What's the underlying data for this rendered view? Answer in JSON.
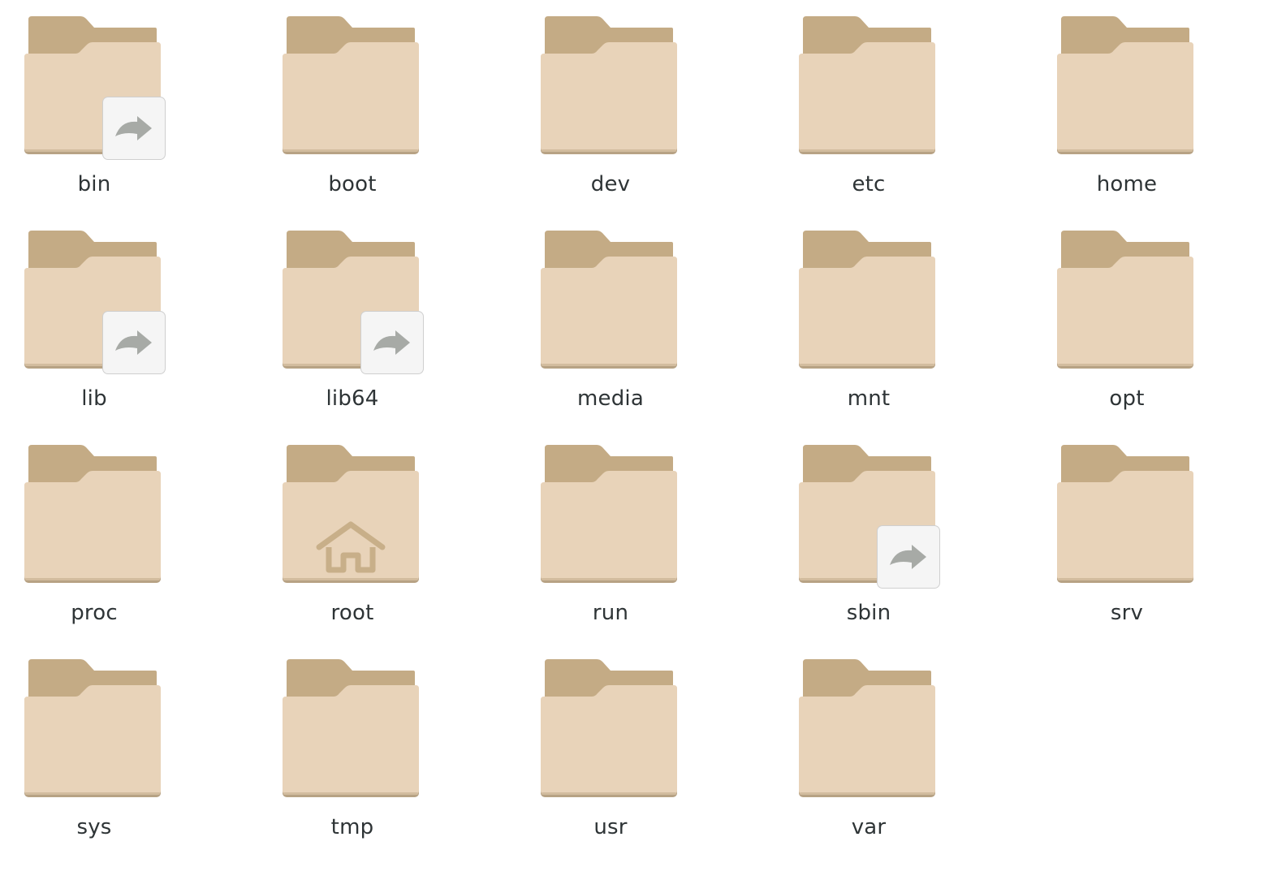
{
  "colors": {
    "folder_back": "#c4ab85",
    "folder_front": "#e8d3b9",
    "folder_shadow": "#b7a284",
    "symlink_badge_bg": "#f5f5f5",
    "symlink_arrow": "#a7aaa6",
    "home_emblem": "#c8af89",
    "label_text": "#2e3436"
  },
  "folders": [
    {
      "name": "bin",
      "emblem": "symlink-icon"
    },
    {
      "name": "boot",
      "emblem": ""
    },
    {
      "name": "dev",
      "emblem": ""
    },
    {
      "name": "etc",
      "emblem": ""
    },
    {
      "name": "home",
      "emblem": ""
    },
    {
      "name": "lib",
      "emblem": "symlink-icon"
    },
    {
      "name": "lib64",
      "emblem": "symlink-icon"
    },
    {
      "name": "media",
      "emblem": ""
    },
    {
      "name": "mnt",
      "emblem": ""
    },
    {
      "name": "opt",
      "emblem": ""
    },
    {
      "name": "proc",
      "emblem": ""
    },
    {
      "name": "root",
      "emblem": "home-icon"
    },
    {
      "name": "run",
      "emblem": ""
    },
    {
      "name": "sbin",
      "emblem": "symlink-icon"
    },
    {
      "name": "srv",
      "emblem": ""
    },
    {
      "name": "sys",
      "emblem": ""
    },
    {
      "name": "tmp",
      "emblem": ""
    },
    {
      "name": "usr",
      "emblem": ""
    },
    {
      "name": "var",
      "emblem": ""
    }
  ]
}
